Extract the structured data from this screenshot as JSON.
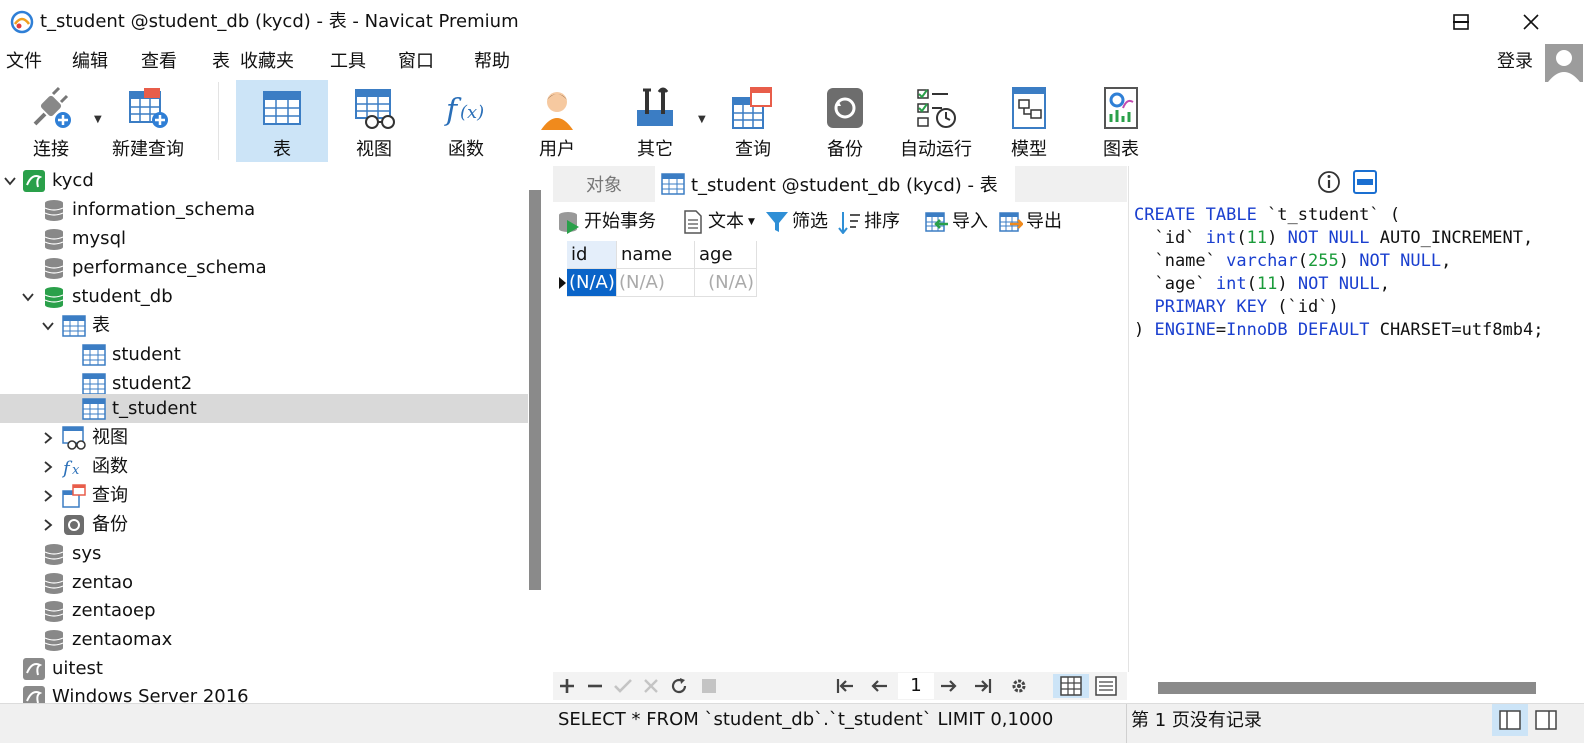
{
  "window": {
    "title": "t_student @student_db (kycd) - 表 - Navicat Premium"
  },
  "menu": {
    "items": [
      "文件",
      "编辑",
      "查看",
      "表",
      "收藏夹",
      "工具",
      "窗口",
      "帮助"
    ],
    "login": "登录"
  },
  "toolbar": {
    "connect": "连接",
    "new_query": "新建查询",
    "table": "表",
    "view": "视图",
    "function": "函数",
    "user": "用户",
    "other": "其它",
    "query": "查询",
    "backup": "备份",
    "automation": "自动运行",
    "model": "模型",
    "chart": "图表"
  },
  "tree": {
    "connection": "kycd",
    "databases": [
      "information_schema",
      "mysql",
      "performance_schema",
      "student_db"
    ],
    "tables_group": "表",
    "tables": [
      "student",
      "student2",
      "t_student"
    ],
    "groups": [
      "视图",
      "函数",
      "查询",
      "备份"
    ],
    "more_databases": [
      "sys",
      "zentao",
      "zentaoep",
      "zentaomax"
    ],
    "other_connections": [
      "uitest",
      "Windows Server 2016"
    ]
  },
  "tabs": {
    "objects": "对象",
    "table_tab": "t_student @student_db (kycd) - 表"
  },
  "data_toolbar": {
    "begin_transaction": "开始事务",
    "text": "文本",
    "filter": "筛选",
    "sort": "排序",
    "import": "导入",
    "export": "导出"
  },
  "grid": {
    "columns": [
      "id",
      "name",
      "age"
    ],
    "row": [
      "(N/A)",
      "(N/A)",
      "(N/A)"
    ]
  },
  "pagination": {
    "page": "1"
  },
  "ddl": {
    "line1_kw": "CREATE TABLE",
    "line1_rest": " `t_student` (",
    "line2_a": "  `id` ",
    "line2_type": "int",
    "line2_num": "11",
    "line2_kw": "NOT NULL",
    "line2_rest": " AUTO_INCREMENT,",
    "line3_a": "  `name` ",
    "line3_type": "varchar",
    "line3_num": "255",
    "line3_kw": "NOT NULL",
    "line4_a": "  `age` ",
    "line4_type": "int",
    "line4_num": "11",
    "line4_kw": "NOT NULL",
    "line5_kw": "  PRIMARY KEY",
    "line5_rest": " (`id`)",
    "line6_a": ") ",
    "line6_kw1": "ENGINE",
    "line6_eq": "=",
    "line6_engine": "InnoDB",
    "line6_kw2": " DEFAULT",
    "line6_rest": " CHARSET=utf8mb4;"
  },
  "status": {
    "sql": "SELECT * FROM `student_db`.`t_student` LIMIT 0,1000",
    "page_info": "第 1 页没有记录"
  },
  "colors": {
    "accent": "#cce4f7",
    "selection": "#0a64c8",
    "keyword": "#1a3fcf",
    "number": "#1a9b3a"
  }
}
